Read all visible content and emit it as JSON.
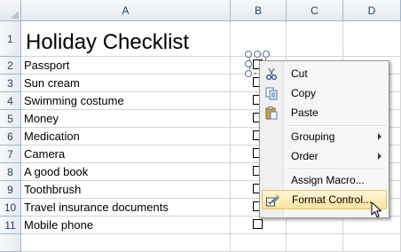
{
  "columns": [
    "A",
    "B",
    "C",
    "D"
  ],
  "rows": [
    "1",
    "2",
    "3",
    "4",
    "5",
    "6",
    "7",
    "8",
    "9",
    "10",
    "11"
  ],
  "title": "Holiday Checklist",
  "items": [
    "Passport",
    "Sun cream",
    "Swimming costume",
    "Money",
    "Medication",
    "Camera",
    "A good book",
    "Toothbrush",
    "Travel insurance documents",
    "Mobile phone"
  ],
  "context_menu": {
    "items": [
      {
        "label": "Cut",
        "icon": "scissors-icon"
      },
      {
        "label": "Copy",
        "icon": "copy-icon"
      },
      {
        "label": "Paste",
        "icon": "paste-icon"
      },
      {
        "label": "Grouping",
        "submenu": true
      },
      {
        "label": "Order",
        "submenu": true
      },
      {
        "label": "Assign Macro..."
      },
      {
        "label": "Format Control...",
        "icon": "format-control-icon",
        "highlighted": true
      }
    ]
  },
  "colors": {
    "header_text": "#27415f",
    "grid_line": "#d4d4d4",
    "header_border": "#9eb6ce",
    "menu_highlight": "#fbe39c"
  }
}
